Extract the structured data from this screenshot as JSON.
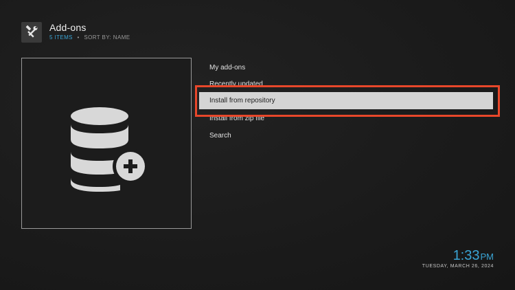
{
  "header": {
    "icon": "tools-icon",
    "title": "Add-ons",
    "item_count": "5 ITEMS",
    "separator": "•",
    "sort_label": "SORT BY: NAME"
  },
  "thumbnail": {
    "icon": "database-add-icon"
  },
  "menu": {
    "items": [
      {
        "label": "My add-ons",
        "selected": false
      },
      {
        "label": "Recently updated",
        "selected": false
      },
      {
        "label": "Install from repository",
        "selected": true
      },
      {
        "label": "Install from zip file",
        "selected": false
      },
      {
        "label": "Search",
        "selected": false
      }
    ]
  },
  "clock": {
    "time": "1:33",
    "ampm": "PM",
    "date": "TUESDAY, MARCH 26, 2024"
  },
  "colors": {
    "accent": "#3aa5d6",
    "highlight_border": "#e8472a",
    "selected_bg": "#d4d4d4",
    "background": "#1b1b1b"
  }
}
